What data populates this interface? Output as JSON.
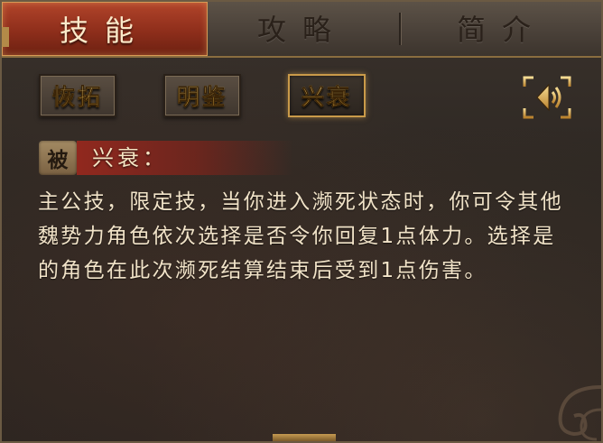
{
  "tabs": [
    {
      "label": "技能",
      "active": true
    },
    {
      "label": "攻略",
      "active": false
    },
    {
      "label": "简介",
      "active": false
    }
  ],
  "skills": [
    {
      "label": "恢拓",
      "selected": false
    },
    {
      "label": "明鉴",
      "selected": false
    },
    {
      "label": "兴衰",
      "selected": true
    }
  ],
  "sound_button": {
    "icon": "speaker-icon"
  },
  "skill_detail": {
    "badge": "被",
    "title": "兴衰：",
    "description": "主公技，限定技，当你进入濒死状态时，你可令其他魏势力角色依次选择是否令你回复1点体力。选择是的角色在此次濒死结算结束后受到1点伤害。"
  },
  "colors": {
    "active_tab": "#8e2e1b",
    "gold_text": "#e2b54c",
    "body_text": "#f1e3c8",
    "panel_bg": "#2e2823"
  }
}
